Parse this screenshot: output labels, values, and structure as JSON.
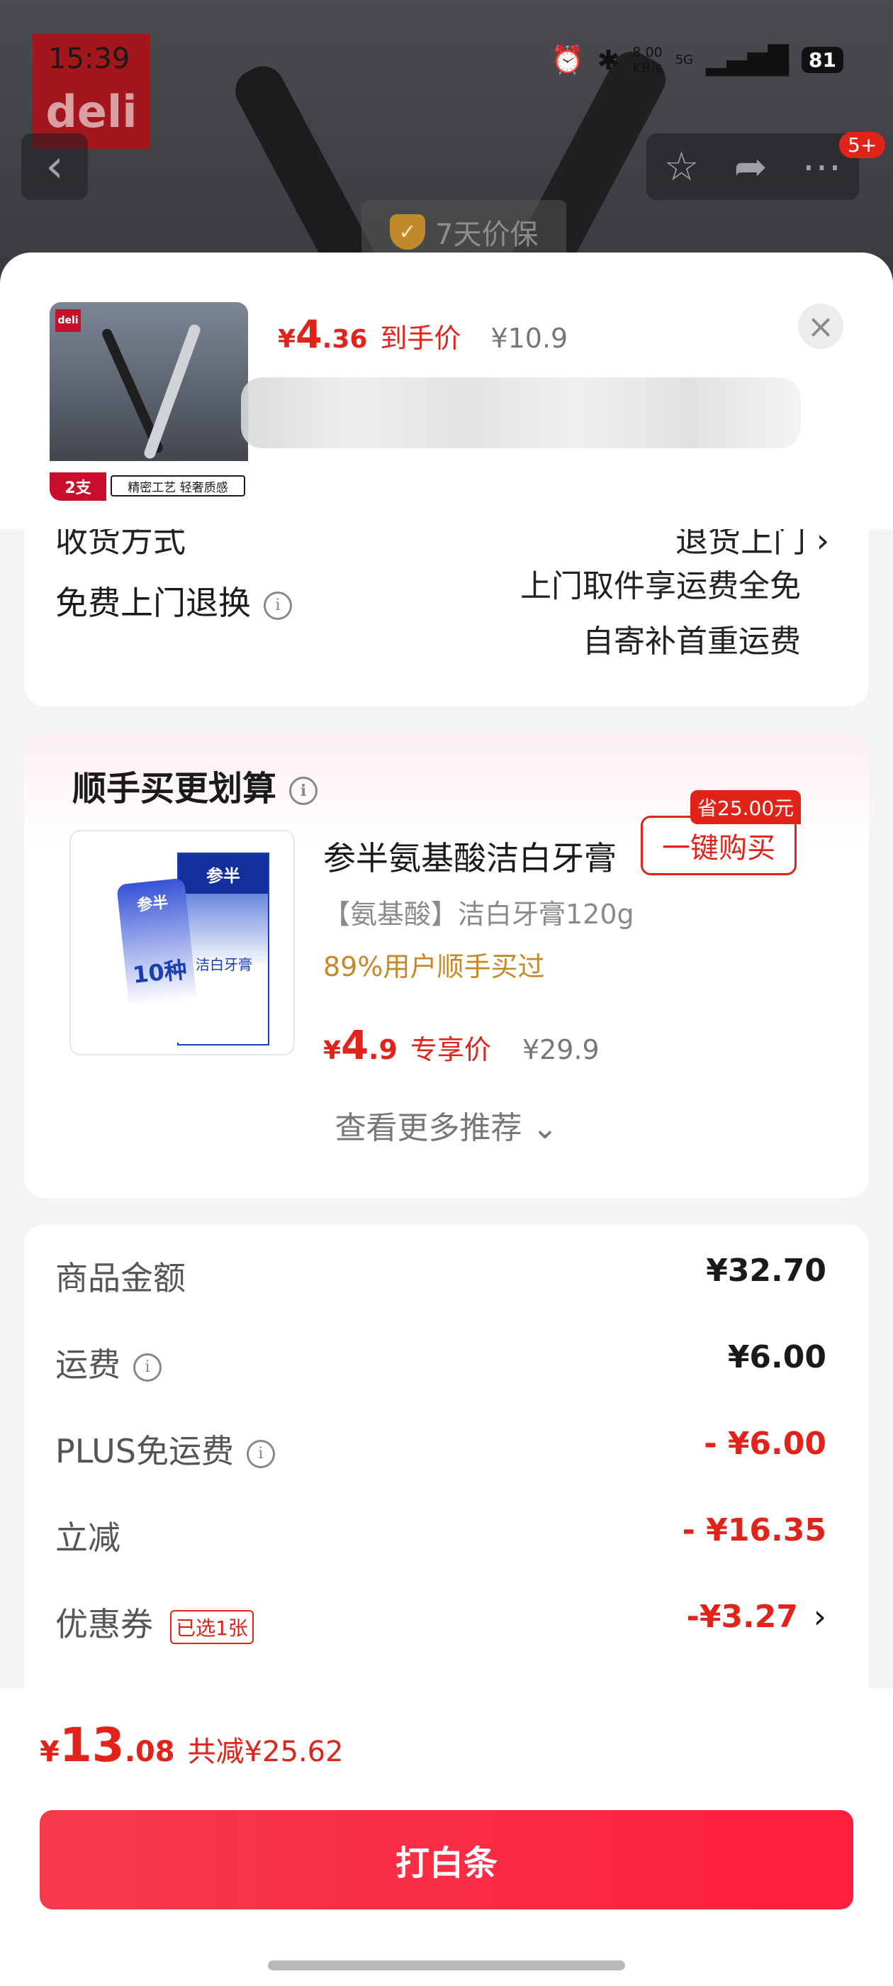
{
  "status_bar": {
    "time": "15:39",
    "speed": "8.00\nKB/s",
    "network": "5G",
    "battery": "81"
  },
  "backdrop": {
    "brand_logo": "deli",
    "guarantee": "7天价保",
    "badge": "5+"
  },
  "product": {
    "price_symbol": "¥",
    "price_int": "4",
    "price_dec": ".36",
    "price_label": "到手价",
    "original_price": "¥10.9",
    "thumb_brand": "deli",
    "thumb_qty": "2支",
    "thumb_tag": "精密工艺 轻奢质感"
  },
  "shipping": {
    "cut_label": "收货方式",
    "cut_value": "退货上门 ›"
  },
  "returns": {
    "title": "免费上门退换",
    "line1": "上门取件享运费全免",
    "line2": "自寄补首重运费"
  },
  "recommend": {
    "title": "顺手买更划算",
    "name": "参半氨基酸洁白牙膏",
    "spec": "【氨基酸】洁白牙膏120g",
    "buyers": "89%用户顺手买过",
    "price_symbol": "¥",
    "price_int": "4",
    "price_dec": ".9",
    "price_label": "专享价",
    "original_price": "¥29.9",
    "save_tag": "省25.00元",
    "buy_label": "一键购买",
    "more_label": "查看更多推荐 ⌄",
    "img_text": {
      "brand": "参半",
      "box_title": "洁白牙膏",
      "tube_big": "10种"
    }
  },
  "amounts": {
    "rows": [
      {
        "label": "商品金额",
        "value": "¥32.70"
      },
      {
        "label": "运费",
        "value": "¥6.00"
      },
      {
        "label": "PLUS免运费",
        "value": "- ¥6.00"
      },
      {
        "label": "立减",
        "value": "- ¥16.35"
      },
      {
        "label": "优惠券",
        "value": "-¥3.27",
        "chip": "已选1张"
      }
    ]
  },
  "bottom": {
    "symbol": "¥",
    "total_int": "13",
    "total_dec": ".08",
    "reduced": "共减¥25.62",
    "pay_label": "打白条"
  }
}
